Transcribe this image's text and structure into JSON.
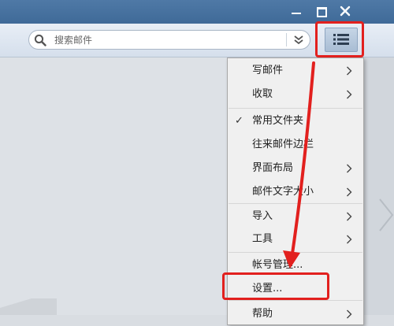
{
  "search": {
    "placeholder": "搜索邮件"
  },
  "menu": {
    "items": [
      {
        "label": "写邮件",
        "has_submenu": true,
        "checked": false
      },
      {
        "label": "收取",
        "has_submenu": true,
        "checked": false
      },
      {
        "label": "常用文件夹",
        "has_submenu": false,
        "checked": true
      },
      {
        "label": "往来邮件边栏",
        "has_submenu": false,
        "checked": false
      },
      {
        "label": "界面布局",
        "has_submenu": true,
        "checked": false
      },
      {
        "label": "邮件文字大小",
        "has_submenu": true,
        "checked": false
      },
      {
        "label": "导入",
        "has_submenu": true,
        "checked": false
      },
      {
        "label": "工具",
        "has_submenu": true,
        "checked": false
      },
      {
        "label": "帐号管理...",
        "has_submenu": false,
        "checked": false
      },
      {
        "label": "设置...",
        "has_submenu": false,
        "checked": false
      },
      {
        "label": "帮助",
        "has_submenu": true,
        "checked": false
      }
    ],
    "check_glyph": "✓"
  },
  "colors": {
    "titlebar": "#4a74a2",
    "annotation": "#e2201e"
  }
}
